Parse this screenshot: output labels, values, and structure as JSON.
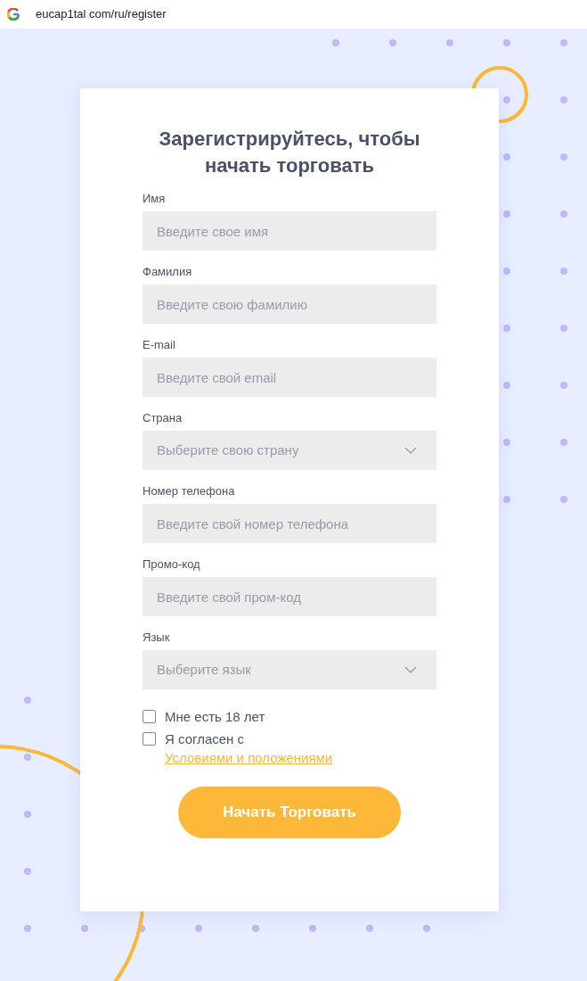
{
  "address_bar": {
    "url": "eucap1tal com/ru/register"
  },
  "form": {
    "title": "Зарегистрируйтесь, чтобы начать торговать",
    "fields": [
      {
        "label": "Имя",
        "placeholder": "Введите свое имя",
        "kind": "input"
      },
      {
        "label": "Фамилия",
        "placeholder": "Введите свою фамилию",
        "kind": "input"
      },
      {
        "label": "E-mail",
        "placeholder": "Введите свой email",
        "kind": "input"
      },
      {
        "label": "Страна",
        "placeholder": "Выберите свою страну",
        "kind": "select"
      },
      {
        "label": "Номер телефона",
        "placeholder": "Введите свой номер телефона",
        "kind": "input"
      },
      {
        "label": "Промо-код",
        "placeholder": "Введите свой пром-код",
        "kind": "input"
      },
      {
        "label": "Язык",
        "placeholder": "Выберите язык",
        "kind": "select"
      }
    ],
    "checkboxes": [
      {
        "label": "Мне есть 18 лет",
        "checked": false
      },
      {
        "label": "Я согласен с",
        "link": "Условиями и положениями",
        "checked": false
      }
    ],
    "submit": "Начать Торговать"
  }
}
